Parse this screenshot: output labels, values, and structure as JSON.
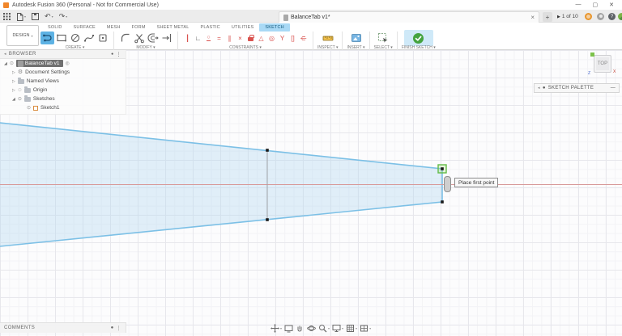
{
  "glyphs": {
    "caret": "▾",
    "minimize": "—",
    "maximize": "▢",
    "close": "✕",
    "tab_close": "×",
    "new_tab": "+",
    "collapse": "◂",
    "dot": "●",
    "kebab": "⋮",
    "eye": "⊙",
    "tri_collapsed": "▷",
    "tri_expanded": "◢",
    "gear": "⚙",
    "undo": "↶",
    "redo": "↷",
    "play": "▶",
    "question": "?",
    "after_circle": "◎"
  },
  "window": {
    "title": "Autodesk Fusion 360 (Personal - Not for Commercial Use)"
  },
  "app_bar": {
    "document_tab": "BalanceTab v1*",
    "job_status": "1 of 10"
  },
  "ribbon": {
    "workspace": "DESIGN",
    "tabs": [
      {
        "label": "SOLID"
      },
      {
        "label": "SURFACE"
      },
      {
        "label": "MESH"
      },
      {
        "label": "FORM"
      },
      {
        "label": "SHEET METAL"
      },
      {
        "label": "PLASTIC"
      },
      {
        "label": "UTILITIES"
      },
      {
        "label": "SKETCH",
        "active": true
      }
    ],
    "group_labels": {
      "create": "CREATE ▾",
      "modify": "MODIFY ▾",
      "constraints": "CONSTRAINTS ▾",
      "inspect": "INSPECT ▾",
      "insert": "INSERT ▾",
      "select": "SELECT ▾",
      "finish": "FINISH SKETCH ▾"
    },
    "constraints": [
      {
        "name": "horizontal-vertical",
        "glyph": "┃"
      },
      {
        "name": "coincident",
        "glyph": "∟"
      },
      {
        "name": "tangent",
        "glyph": "○"
      },
      {
        "name": "equal",
        "glyph": "="
      },
      {
        "name": "parallel",
        "glyph": "∥"
      },
      {
        "name": "perpendicular",
        "glyph": "×"
      },
      {
        "name": "fix-unfix",
        "glyph": "lock"
      },
      {
        "name": "smooth",
        "glyph": "△"
      },
      {
        "name": "concentric",
        "glyph": "◎"
      },
      {
        "name": "midpoint",
        "glyph": "Y"
      },
      {
        "name": "symmetry",
        "glyph": "[]"
      },
      {
        "name": "curvature",
        "glyph": "ψ"
      }
    ]
  },
  "browser": {
    "title": "BROWSER",
    "root_item": "BalanceTab v1",
    "items": [
      {
        "label": "Document Settings"
      },
      {
        "label": "Named Views"
      },
      {
        "label": "Origin"
      },
      {
        "label": "Sketches"
      },
      {
        "label": "Sketch1"
      }
    ]
  },
  "viewcube": {
    "face": "TOP",
    "axis_x": "X",
    "axis_z": "Z"
  },
  "sketch_palette": {
    "title": "SKETCH PALETTE"
  },
  "canvas": {
    "tooltip": "Place first point"
  },
  "comments": {
    "title": "COMMENTS"
  },
  "colors": {
    "accent_blue": "#5db2e4",
    "active_tab_blue": "#a9d9f5",
    "sketch_edge": "#7cc0e6",
    "sketch_fill": "rgba(180,215,240,0.38)",
    "axis_red": "#d89a9a",
    "constraint_red": "#d9534f",
    "finish_green": "#44a33f",
    "selected_point_green": "#62bb46"
  }
}
